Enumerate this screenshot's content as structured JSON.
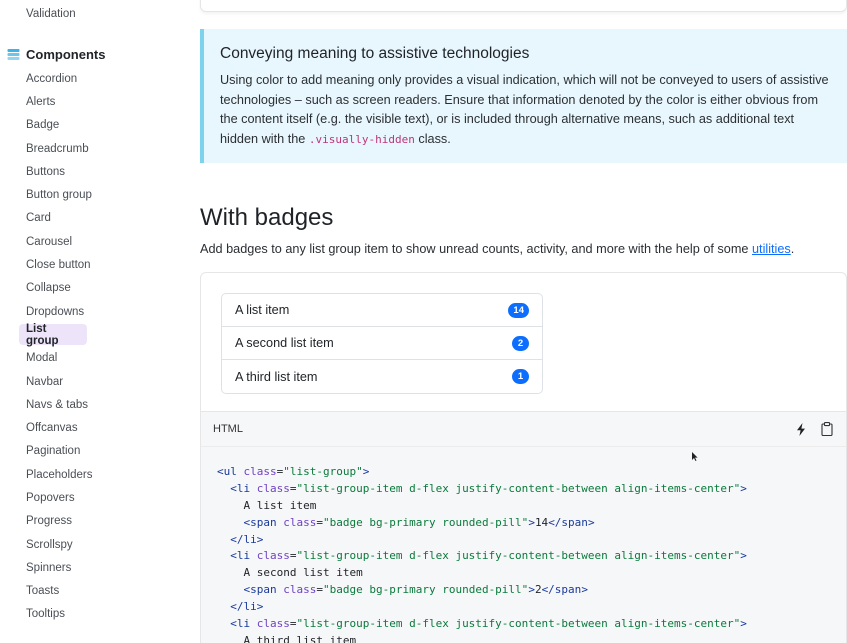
{
  "sidebar": {
    "top_item": "Validation",
    "section": {
      "label": "Components",
      "icon": "components-icon",
      "color": "#3bb3e6"
    },
    "items": [
      {
        "label": "Accordion"
      },
      {
        "label": "Alerts"
      },
      {
        "label": "Badge"
      },
      {
        "label": "Breadcrumb"
      },
      {
        "label": "Buttons"
      },
      {
        "label": "Button group"
      },
      {
        "label": "Card"
      },
      {
        "label": "Carousel"
      },
      {
        "label": "Close button"
      },
      {
        "label": "Collapse"
      },
      {
        "label": "Dropdowns"
      },
      {
        "label": "List group",
        "active": true
      },
      {
        "label": "Modal"
      },
      {
        "label": "Navbar"
      },
      {
        "label": "Navs & tabs"
      },
      {
        "label": "Offcanvas"
      },
      {
        "label": "Pagination"
      },
      {
        "label": "Placeholders"
      },
      {
        "label": "Popovers"
      },
      {
        "label": "Progress"
      },
      {
        "label": "Scrollspy"
      },
      {
        "label": "Spinners"
      },
      {
        "label": "Toasts"
      },
      {
        "label": "Tooltips"
      }
    ]
  },
  "callout": {
    "title": "Conveying meaning to assistive technologies",
    "body_before": "Using color to add meaning only provides a visual indication, which will not be conveyed to users of assistive technologies – such as screen readers. Ensure that information denoted by the color is either obvious from the content itself (e.g. the visible text), or is included through alternative means, such as additional text hidden with the ",
    "code": ".visually-hidden",
    "body_after": " class."
  },
  "section": {
    "title": "With badges",
    "desc_before": "Add badges to any list group item to show unread counts, activity, and more with the help of some ",
    "desc_link": "utilities",
    "desc_after": "."
  },
  "example": {
    "items": [
      {
        "label": "A list item",
        "badge": "14"
      },
      {
        "label": "A second list item",
        "badge": "2"
      },
      {
        "label": "A third list item",
        "badge": "1"
      }
    ],
    "badge_color": "#0d6efd"
  },
  "code": {
    "lang": "HTML",
    "tools": [
      "lightning-icon",
      "clipboard-icon"
    ],
    "lines": [
      "<ul class=\"list-group\">",
      "  <li class=\"list-group-item d-flex justify-content-between align-items-center\">",
      "    A list item",
      "    <span class=\"badge bg-primary rounded-pill\">14</span>",
      "  </li>",
      "  <li class=\"list-group-item d-flex justify-content-between align-items-center\">",
      "    A second list item",
      "    <span class=\"badge bg-primary rounded-pill\">2</span>",
      "  </li>",
      "  <li class=\"list-group-item d-flex justify-content-between align-items-center\">",
      "    A third list item"
    ]
  }
}
